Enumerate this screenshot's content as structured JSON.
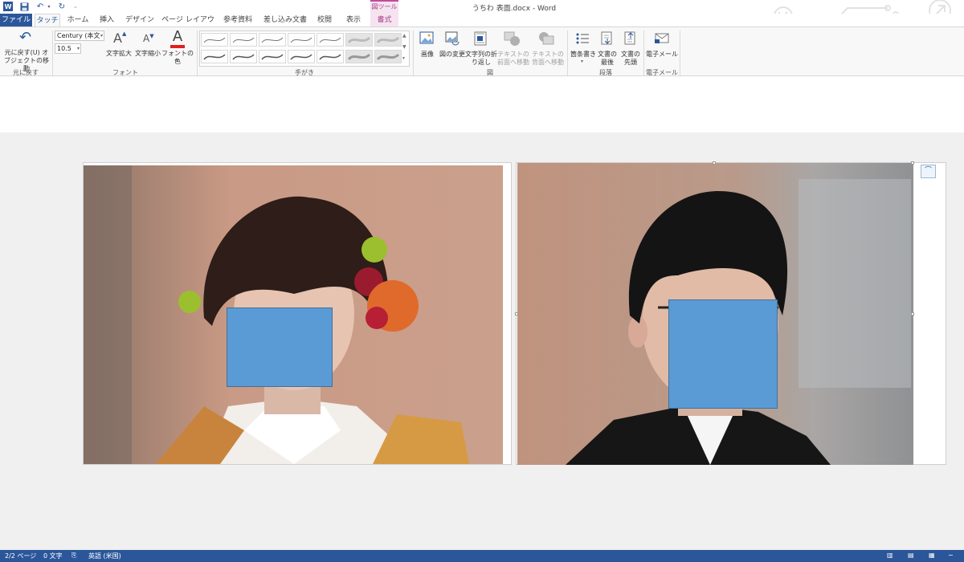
{
  "window": {
    "title": "うちわ 表面.docx - Word",
    "context_tool_group": "図ツール"
  },
  "tabs": [
    "ファイル",
    "タッチ",
    "ホーム",
    "挿入",
    "デザイン",
    "ページ レイアウト",
    "参考資料",
    "差し込み文書",
    "校閲",
    "表示",
    "書式"
  ],
  "ribbon": {
    "undo_group": {
      "label": "元に戻す",
      "undo_button": "元に戻す(U) オブジェクトの移動"
    },
    "font_group": {
      "label": "フォント",
      "font_name": "Century (本文",
      "font_size": "10.5",
      "grow": "文字拡大",
      "shrink": "文字縮小",
      "color": "フォントの色"
    },
    "ink_group": {
      "label": "手がき"
    },
    "picture_group": {
      "label": "図",
      "picture": "画像",
      "change_picture": "図の変更",
      "wrap_text": "文字列の折り返し",
      "bring_to_front_text": "テキストの前面へ移動",
      "send_behind_text": "テキストの背面へ移動"
    },
    "paragraph_group": {
      "label": "段落",
      "bullets": "箇条書き",
      "doc_end": "文書の最後",
      "doc_start": "文書の先頭"
    },
    "email_group": {
      "label": "電子メール",
      "email": "電子メール"
    }
  },
  "status": {
    "page": "2/2 ページ",
    "words": "0 文字",
    "language": "英語 (米国)"
  },
  "colors": {
    "word_blue": "#2b579a",
    "picture_tools_pink": "#a33f87",
    "face_mask": "#5b9bd5"
  }
}
